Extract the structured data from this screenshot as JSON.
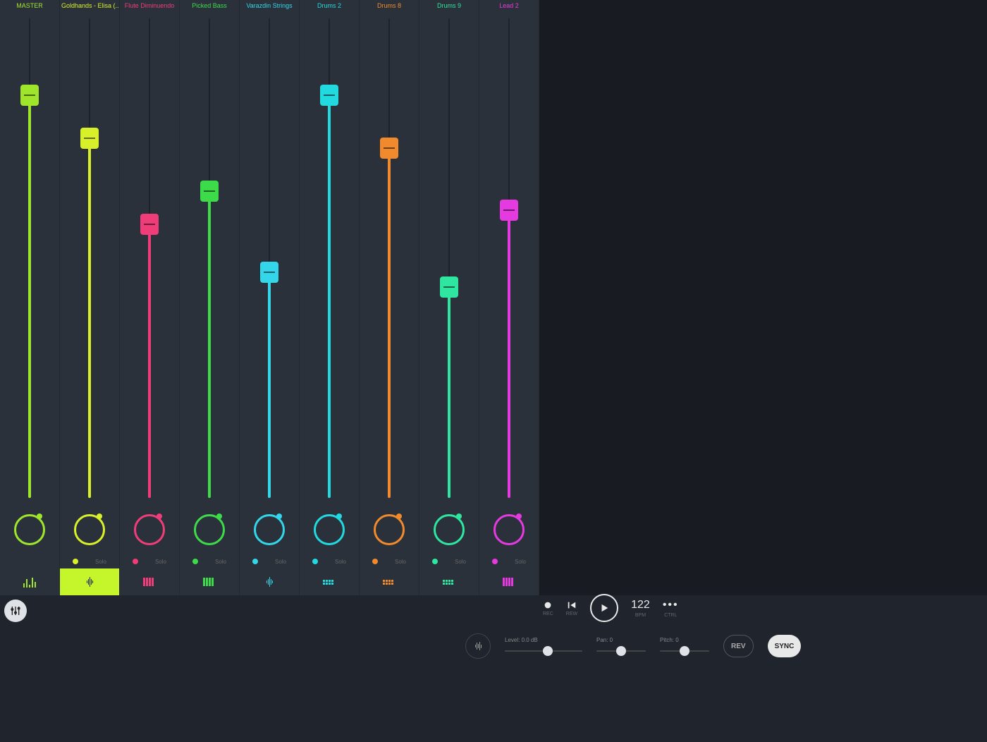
{
  "channels": [
    {
      "name": "MASTER",
      "color": "#9fe52b",
      "fader": 0.84,
      "icon": "levels",
      "selected": false,
      "hasMuteSolo": false
    },
    {
      "name": "Goldhands - Elisa (...ocal)",
      "color": "#d8f02a",
      "fader": 0.75,
      "icon": "wave",
      "selected": true,
      "hasMuteSolo": true
    },
    {
      "name": "Flute Diminuendo",
      "color": "#ef3d7a",
      "fader": 0.57,
      "icon": "keys",
      "selected": false,
      "hasMuteSolo": true
    },
    {
      "name": "Picked Bass",
      "color": "#3ddb4a",
      "fader": 0.64,
      "icon": "keys",
      "selected": false,
      "hasMuteSolo": true
    },
    {
      "name": "Varazdin Strings",
      "color": "#34d6ea",
      "fader": 0.47,
      "icon": "wave-thin",
      "selected": false,
      "hasMuteSolo": true
    },
    {
      "name": "Drums 2",
      "color": "#23d9e0",
      "fader": 0.84,
      "icon": "pads",
      "selected": false,
      "hasMuteSolo": true
    },
    {
      "name": "Drums 8",
      "color": "#f08a2c",
      "fader": 0.73,
      "icon": "pads",
      "selected": false,
      "hasMuteSolo": true
    },
    {
      "name": "Drums 9",
      "color": "#2ee6a0",
      "fader": 0.44,
      "icon": "pads",
      "selected": false,
      "hasMuteSolo": true
    },
    {
      "name": "Lead 2",
      "color": "#e53adf",
      "fader": 0.6,
      "icon": "keys",
      "selected": false,
      "hasMuteSolo": true
    }
  ],
  "solo_label": "Solo",
  "transport": {
    "rec_label": "REC",
    "rew_label": "REW",
    "bpm_value": "122",
    "bpm_label": "BPM",
    "ctrl_label": "CTRL"
  },
  "detail": {
    "level_label": "Level: 0.0 dB",
    "level_pos": 0.55,
    "level_width": 110,
    "pan_label": "Pan: 0",
    "pan_pos": 0.5,
    "pan_width": 70,
    "pitch_label": "Pitch: 0",
    "pitch_pos": 0.5,
    "pitch_width": 70,
    "rev_label": "REV",
    "sync_label": "SYNC"
  }
}
